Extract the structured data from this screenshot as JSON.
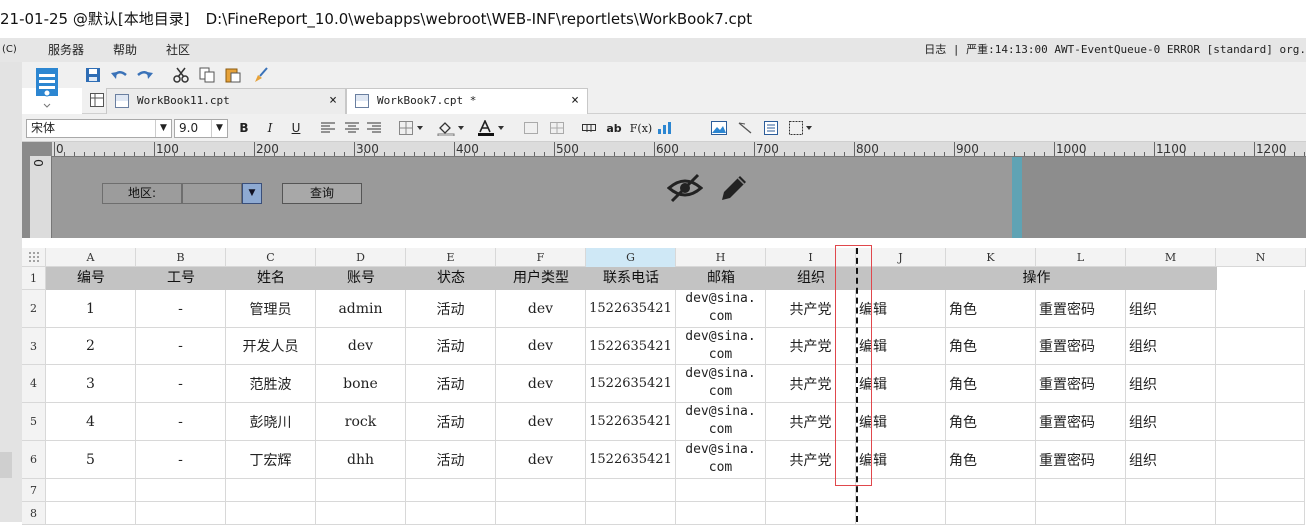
{
  "window": {
    "title_date": "21-01-25 @默认[本地目录]",
    "file_path": "D:\\FineReport_10.0\\webapps\\webroot\\WEB-INF\\reportlets\\WorkBook7.cpt"
  },
  "menu": {
    "copyright": "(C)",
    "items": [
      "服务器",
      "帮助",
      "社区"
    ],
    "log_label": "日志",
    "log_sep": "|",
    "log_text": "严重:14:13:00 AWT-EventQueue-0 ERROR [standard] org."
  },
  "tabs": [
    {
      "label": "WorkBook11.cpt",
      "close": "×"
    },
    {
      "label": "WorkBook7.cpt *",
      "close": "×"
    }
  ],
  "format": {
    "font_name": "宋体",
    "font_size": "9.0",
    "bold": "B",
    "italic": "I",
    "underline": "U",
    "text_icon": "ab",
    "formula_icon": "F(x)"
  },
  "ruler": {
    "ticks": [
      "0",
      "100",
      "200",
      "300",
      "400",
      "500",
      "600",
      "700",
      "800",
      "900",
      "1000",
      "1100",
      "1200"
    ],
    "vertical_zero": "0"
  },
  "param": {
    "label": "地区:",
    "query_button": "查询"
  },
  "grid": {
    "columns": [
      "A",
      "B",
      "C",
      "D",
      "E",
      "F",
      "G",
      "H",
      "I",
      "J",
      "K",
      "L",
      "M",
      "N"
    ],
    "row_numbers": [
      "1",
      "2",
      "3",
      "4",
      "5",
      "6",
      "7",
      "8"
    ],
    "headers": [
      "编号",
      "工号",
      "姓名",
      "账号",
      "状态",
      "用户类型",
      "联系电话",
      "邮箱",
      "组织",
      "操作"
    ],
    "rows": [
      {
        "id": "1",
        "no": "-",
        "name": "管理员",
        "account": "admin",
        "status": "活动",
        "type": "dev",
        "phone": "1522635421",
        "mail1": "dev@sina.",
        "mail2": "com",
        "org": "共产党",
        "op1": "编辑",
        "op2": "角色",
        "op3": "重置密码",
        "op4": "组织"
      },
      {
        "id": "2",
        "no": "-",
        "name": "开发人员",
        "account": "dev",
        "status": "活动",
        "type": "dev",
        "phone": "1522635421",
        "mail1": "dev@sina.",
        "mail2": "com",
        "org": "共产党",
        "op1": "编辑",
        "op2": "角色",
        "op3": "重置密码",
        "op4": "组织"
      },
      {
        "id": "3",
        "no": "-",
        "name": "范胜波",
        "account": "bone",
        "status": "活动",
        "type": "dev",
        "phone": "1522635421",
        "mail1": "dev@sina.",
        "mail2": "com",
        "org": "共产党",
        "op1": "编辑",
        "op2": "角色",
        "op3": "重置密码",
        "op4": "组织"
      },
      {
        "id": "4",
        "no": "-",
        "name": "彭晓川",
        "account": "rock",
        "status": "活动",
        "type": "dev",
        "phone": "1522635421",
        "mail1": "dev@sina.",
        "mail2": "com",
        "org": "共产党",
        "op1": "编辑",
        "op2": "角色",
        "op3": "重置密码",
        "op4": "组织"
      },
      {
        "id": "5",
        "no": "-",
        "name": "丁宏辉",
        "account": "dhh",
        "status": "活动",
        "type": "dev",
        "phone": "1522635421",
        "mail1": "dev@sina.",
        "mail2": "com",
        "org": "共产党",
        "op1": "编辑",
        "op2": "角色",
        "op3": "重置密码",
        "op4": "组织"
      }
    ]
  },
  "icons": [
    "save-icon",
    "undo-icon",
    "redo-icon",
    "cut-icon",
    "copy-icon",
    "paste-icon",
    "format-brush-icon",
    "hide-icon",
    "edit-pencil-icon"
  ],
  "colors": {
    "selected_col": "#cfe8f6",
    "highlight_box": "#e0474c",
    "canvas_bar": "#5fa3b4"
  }
}
